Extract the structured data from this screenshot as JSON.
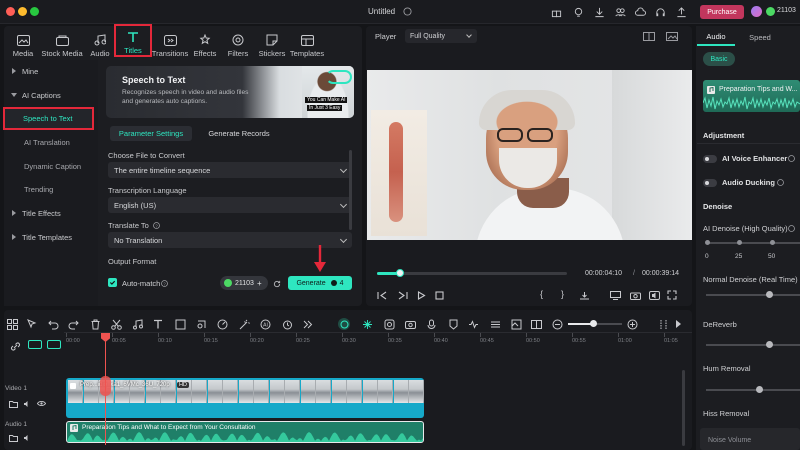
{
  "window": {
    "title": "Untitled",
    "purchase_label": "Purchase",
    "credits": "21103"
  },
  "media_tabs": [
    {
      "label": "Media",
      "icon": "media-icon"
    },
    {
      "label": "Stock Media",
      "icon": "stock-media-icon"
    },
    {
      "label": "Audio",
      "icon": "audio-icon"
    },
    {
      "label": "Titles",
      "icon": "titles-icon",
      "active": true
    },
    {
      "label": "Transitions",
      "icon": "transitions-icon"
    },
    {
      "label": "Effects",
      "icon": "effects-icon"
    },
    {
      "label": "Filters",
      "icon": "filters-icon"
    },
    {
      "label": "Stickers",
      "icon": "stickers-icon"
    },
    {
      "label": "Templates",
      "icon": "templates-icon"
    }
  ],
  "sidebar": {
    "items": [
      {
        "label": "Mine"
      },
      {
        "label": "AI Captions"
      },
      {
        "label": "Speech to Text",
        "active": true
      },
      {
        "label": "AI Translation"
      },
      {
        "label": "Dynamic Caption"
      },
      {
        "label": "Trending"
      },
      {
        "label": "Title Effects"
      },
      {
        "label": "Title Templates"
      }
    ]
  },
  "banner": {
    "title": "Speech to Text",
    "description": "Recognizes speech in video and audio files and generates auto captions.",
    "image_caption_1": "You Can Make AI",
    "image_caption_2": "In Just 3 Easy"
  },
  "stt_tabs": {
    "parameter_settings": "Parameter Settings",
    "generate_records": "Generate Records"
  },
  "form": {
    "file_label": "Choose File to Convert",
    "file_value": "The entire timeline sequence",
    "language_label": "Transcription Language",
    "language_value": "English (US)",
    "translate_label": "Translate To",
    "translate_value": "No Translation",
    "output_label": "Output Format",
    "automatch_label": "Auto-match",
    "credits_value": "21103",
    "generate_label": "Generate",
    "generate_cost": "4"
  },
  "player": {
    "label": "Player",
    "quality": "Full Quality",
    "current_time": "00:00:04:10",
    "separator": "/",
    "total_time": "00:00:39:14",
    "progress_fraction": 0.12
  },
  "right_panel": {
    "tabs": [
      "Audio",
      "Speed"
    ],
    "basic_label": "Basic",
    "clip_title": "Preparation Tips and W...",
    "adjustment_label": "Adjustment",
    "voice_enhancer": "AI Voice Enhancer",
    "audio_ducking": "Audio Ducking",
    "denoise_label": "Denoise",
    "ai_denoise_label": "AI Denoise (High Quality)",
    "ai_denoise_ticks": [
      "0",
      "25",
      "50"
    ],
    "normal_denoise_label": "Normal Denoise (Real Time)",
    "dereverb_label": "DeReverb",
    "hum_removal_label": "Hum Removal",
    "hiss_removal_label": "Hiss Removal",
    "noise_volume_label": "Noise Volume"
  },
  "timeline": {
    "ruler": [
      "00:00",
      "00:05",
      "00:10",
      "00:15",
      "00:20",
      "00:25",
      "00:30",
      "00:35",
      "00:40",
      "00:45",
      "00:50",
      "00:55",
      "01:00",
      "01:05"
    ],
    "video_track_label": "Video 1",
    "audio_track_label": "Audio 1",
    "video_clip_label": "Prep...idio_xa1_6VMc_36U_720p",
    "video_clip_badge": "HD",
    "audio_clip_label": "Preparation Tips and What to Expect from Your Consultation"
  },
  "colors": {
    "accent_teal": "#2ee6c0",
    "highlight_red": "#e4283a",
    "playhead": "#ef5350",
    "video_clip": "#16a9c9",
    "audio_clip": "#1f7f68"
  }
}
